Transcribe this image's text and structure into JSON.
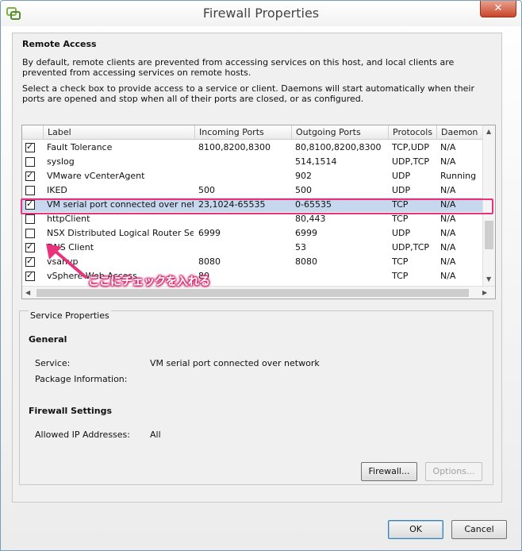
{
  "window": {
    "title": "Firewall Properties",
    "close_glyph": "✕"
  },
  "remote_access": {
    "title": "Remote Access",
    "desc1": "By default, remote clients are prevented from accessing services on this host, and local clients are prevented from accessing services on remote hosts.",
    "desc2": "Select a check box to provide access to a service or client. Daemons will start automatically when their ports are opened and stop when all of their ports are closed, or as configured."
  },
  "table": {
    "columns": [
      "Label",
      "Incoming Ports",
      "Outgoing Ports",
      "Protocols",
      "Daemon"
    ],
    "rows": [
      {
        "checked": true,
        "label": "Fault Tolerance",
        "incoming": "8100,8200,8300",
        "outgoing": "80,8100,8200,8300",
        "protocols": "TCP,UDP",
        "daemon": "N/A"
      },
      {
        "checked": false,
        "label": "syslog",
        "incoming": "",
        "outgoing": "514,1514",
        "protocols": "UDP,TCP",
        "daemon": "N/A"
      },
      {
        "checked": true,
        "label": "VMware vCenterAgent",
        "incoming": "",
        "outgoing": "902",
        "protocols": "UDP",
        "daemon": "Running"
      },
      {
        "checked": false,
        "label": "IKED",
        "incoming": "500",
        "outgoing": "500",
        "protocols": "UDP",
        "daemon": "N/A"
      },
      {
        "checked": true,
        "label": "VM serial port connected over net...",
        "incoming": "23,1024-65535",
        "outgoing": "0-65535",
        "protocols": "TCP",
        "daemon": "N/A",
        "selected": true
      },
      {
        "checked": false,
        "label": "httpClient",
        "incoming": "",
        "outgoing": "80,443",
        "protocols": "TCP",
        "daemon": "N/A"
      },
      {
        "checked": false,
        "label": "NSX Distributed Logical Router Ser...",
        "incoming": "6999",
        "outgoing": "6999",
        "protocols": "UDP",
        "daemon": "N/A"
      },
      {
        "checked": true,
        "label": "DNS Client",
        "incoming": "",
        "outgoing": "53",
        "protocols": "UDP,TCP",
        "daemon": "N/A"
      },
      {
        "checked": true,
        "label": "vsanvp",
        "incoming": "8080",
        "outgoing": "8080",
        "protocols": "TCP",
        "daemon": "N/A"
      },
      {
        "checked": true,
        "label": "vSphere Web Access",
        "incoming": "80",
        "outgoing": "",
        "protocols": "TCP",
        "daemon": "N/A"
      }
    ]
  },
  "annotation": {
    "text": "ここにチェックを入れる",
    "color": "#e8337c"
  },
  "service_properties": {
    "title": "Service Properties",
    "general_title": "General",
    "service_label": "Service:",
    "service_value": "VM serial port connected over network",
    "package_label": "Package Information:",
    "package_value": "",
    "firewall_title": "Firewall Settings",
    "allowed_ip_label": "Allowed IP Addresses:",
    "allowed_ip_value": "All"
  },
  "buttons": {
    "firewall": "Firewall...",
    "options": "Options...",
    "ok": "OK",
    "cancel": "Cancel"
  }
}
